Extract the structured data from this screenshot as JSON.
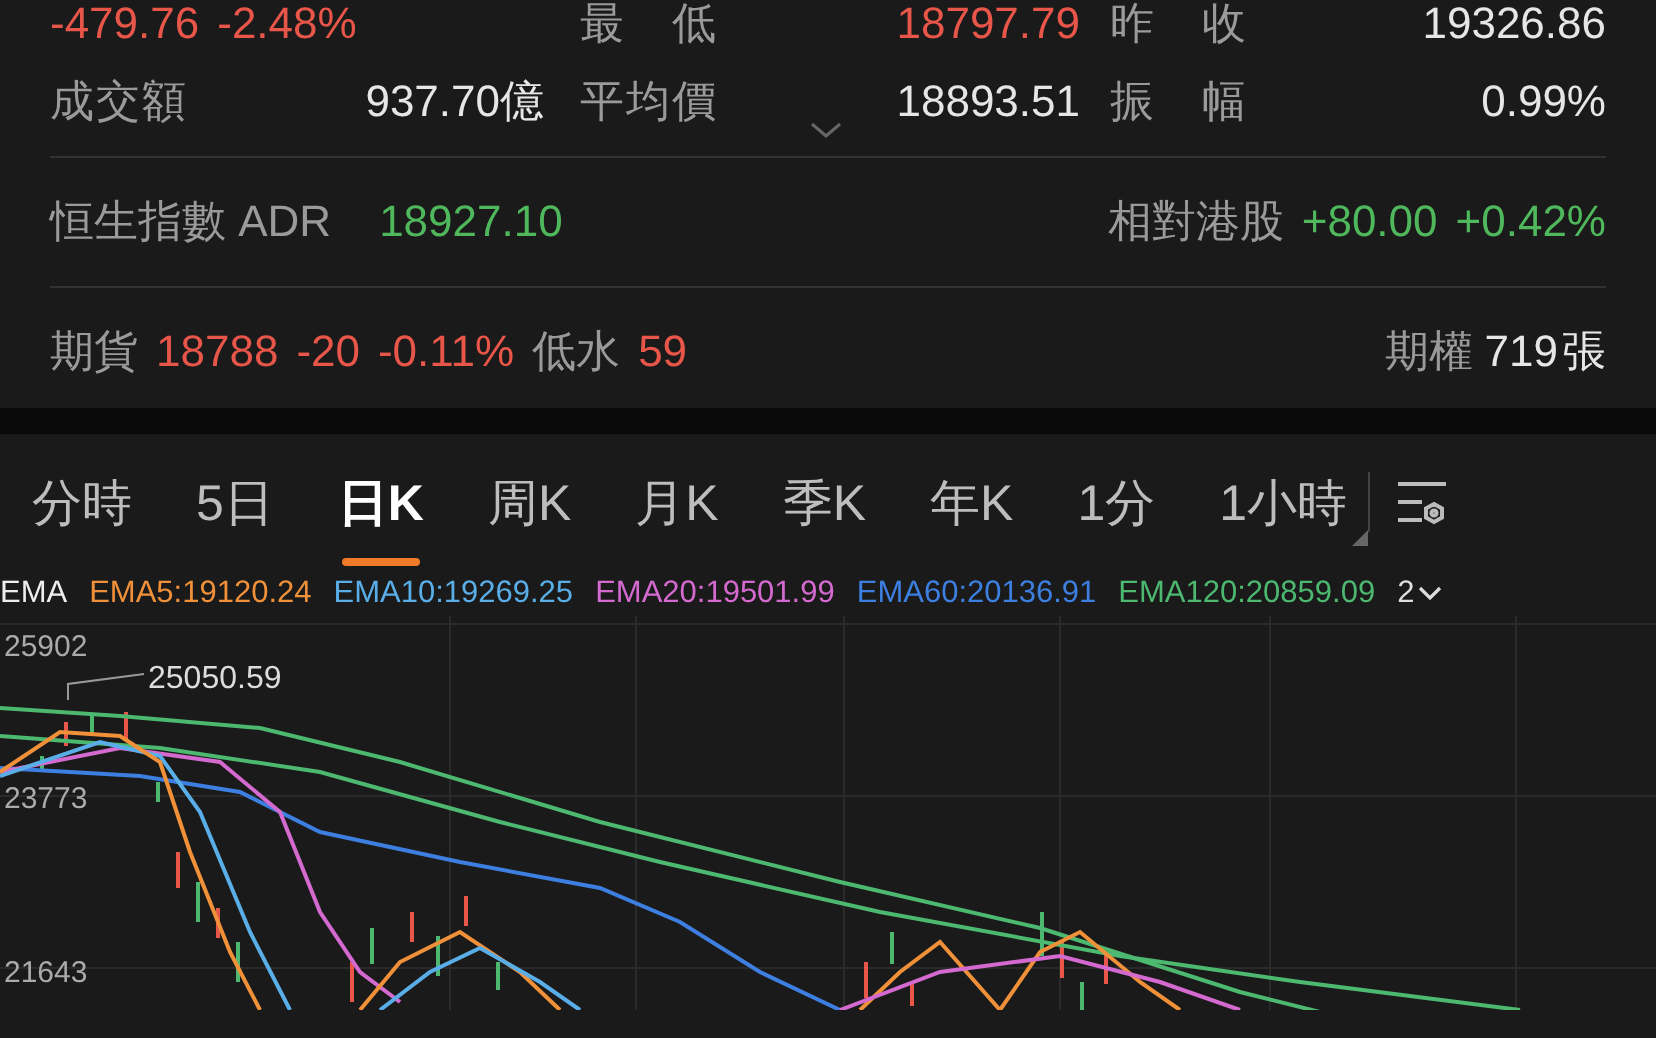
{
  "stats_rows": [
    [
      {
        "kind": "change",
        "change": "-479.76",
        "change_pct": "-2.48%",
        "color": "#e8564a"
      },
      {
        "kind": "stat",
        "label": "最 低",
        "value": "18797.79",
        "color": "#e8564a"
      },
      {
        "kind": "stat",
        "label": "昨 收",
        "value": "19326.86",
        "color": "#e6e6e6"
      }
    ],
    [
      {
        "kind": "stat",
        "label": "成交額",
        "value": "937.70億",
        "color": "#e6e6e6"
      },
      {
        "kind": "stat",
        "label": "平均價",
        "value": "18893.51",
        "color": "#e6e6e6"
      },
      {
        "kind": "stat",
        "label": "振 幅",
        "value": "0.99%",
        "color": "#e6e6e6"
      }
    ]
  ],
  "adr": {
    "label": "恒生指數 ADR",
    "value": "18927.10",
    "color": "#4fb85c",
    "relative": {
      "label": "相對港股",
      "change": "+80.00",
      "pct": "+0.42%",
      "color": "#4fb85c"
    }
  },
  "futures": {
    "label": "期貨",
    "price": "18788",
    "change": "-20",
    "change_pct": "-0.11%",
    "color": "#e8564a",
    "basis": {
      "label": "低水",
      "value": "59",
      "color": "#e8564a"
    },
    "options_label": "期權",
    "options_count": "719",
    "options_unit": "張"
  },
  "tabs": [
    {
      "label": "分時",
      "selected": false
    },
    {
      "label": "5日",
      "selected": false
    },
    {
      "label": "日K",
      "selected": true
    },
    {
      "label": "周K",
      "selected": false
    },
    {
      "label": "月K",
      "selected": false
    },
    {
      "label": "季K",
      "selected": false
    },
    {
      "label": "年K",
      "selected": false
    },
    {
      "label": "1分",
      "selected": false
    },
    {
      "label": "1小時",
      "selected": false
    }
  ],
  "ema": {
    "title": "EMA",
    "items": [
      {
        "label": "EMA5:19120.24",
        "color": "#f0913a"
      },
      {
        "label": "EMA10:19269.25",
        "color": "#5aaee8"
      },
      {
        "label": "EMA20:19501.99",
        "color": "#d46ad0"
      },
      {
        "label": "EMA60:20136.91",
        "color": "#3d7fe0"
      },
      {
        "label": "EMA120:20859.09",
        "color": "#4cb870"
      }
    ],
    "more": "2"
  },
  "chart": {
    "y_labels": [
      "25902",
      "23773",
      "21643"
    ],
    "high_label": "25050.59"
  }
}
